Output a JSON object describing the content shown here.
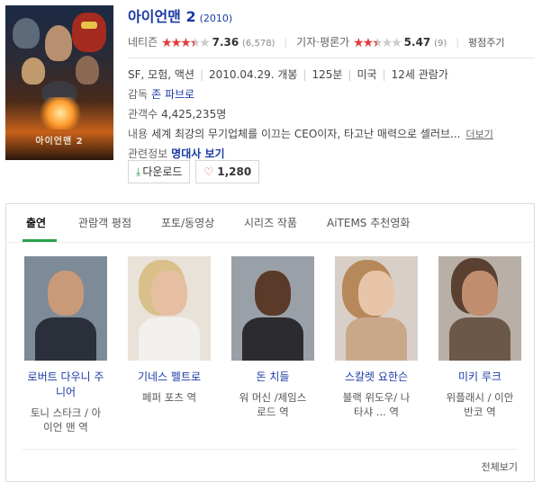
{
  "poster": {
    "title_text": "아이언맨 2"
  },
  "movie": {
    "title": "아이언맨 2",
    "year": "(2010)"
  },
  "ratings": {
    "netizen_label": "네티즌",
    "netizen_score": "7.36",
    "netizen_count": "(6,578)",
    "netizen_stars": 3.5,
    "critic_label": "기자·평론가",
    "critic_score": "5.47",
    "critic_count": "(9)",
    "critic_stars": 2.5,
    "critic_button": "평점주기"
  },
  "meta": {
    "genre": "SF, 모험, 액션",
    "release": "2010.04.29. 개봉",
    "runtime": "125분",
    "country": "미국",
    "age": "12세 관람가",
    "director_label": "감독",
    "director": "존 파브로",
    "audience_label": "관객수",
    "audience": "4,425,235명",
    "content_label": "내용",
    "content": "세계 최강의 무기업체를 이끄는 CEO이자, 타고난 매력으로 셀러브...",
    "more": "더보기",
    "related_label": "관련정보",
    "related": "명대사 보기"
  },
  "buttons": {
    "download": "다운로드",
    "like_count": "1,280"
  },
  "tabs": [
    {
      "label": "출연",
      "active": true
    },
    {
      "label": "관람객 평점",
      "active": false
    },
    {
      "label": "포토/동영상",
      "active": false
    },
    {
      "label": "시리즈 작품",
      "active": false
    },
    {
      "label": "AiTEMS 추천영화",
      "active": false
    }
  ],
  "cast": [
    {
      "name_line1": "로버트 다우니 주",
      "name_line2": "니어",
      "role_line1": "토니 스타크 / 아",
      "role_line2": "이언 맨 역"
    },
    {
      "name_line1": "기네스 펠트로",
      "name_line2": "",
      "role_line1": "페퍼 포츠 역",
      "role_line2": ""
    },
    {
      "name_line1": "돈 치들",
      "name_line2": "",
      "role_line1": "워 머신 /제임스",
      "role_line2": "로드 역"
    },
    {
      "name_line1": "스칼렛 요한슨",
      "name_line2": "",
      "role_line1": "블랙 위도우/ 나",
      "role_line2": "타샤 ... 역"
    },
    {
      "name_line1": "미키 루크",
      "name_line2": "",
      "role_line1": "위플래시 / 이안",
      "role_line2": "반코 역"
    }
  ],
  "view_all": "전체보기",
  "colors": {
    "link": "#1a3aa5",
    "star": "#e23b3b",
    "accent_green": "#2ba24c"
  }
}
